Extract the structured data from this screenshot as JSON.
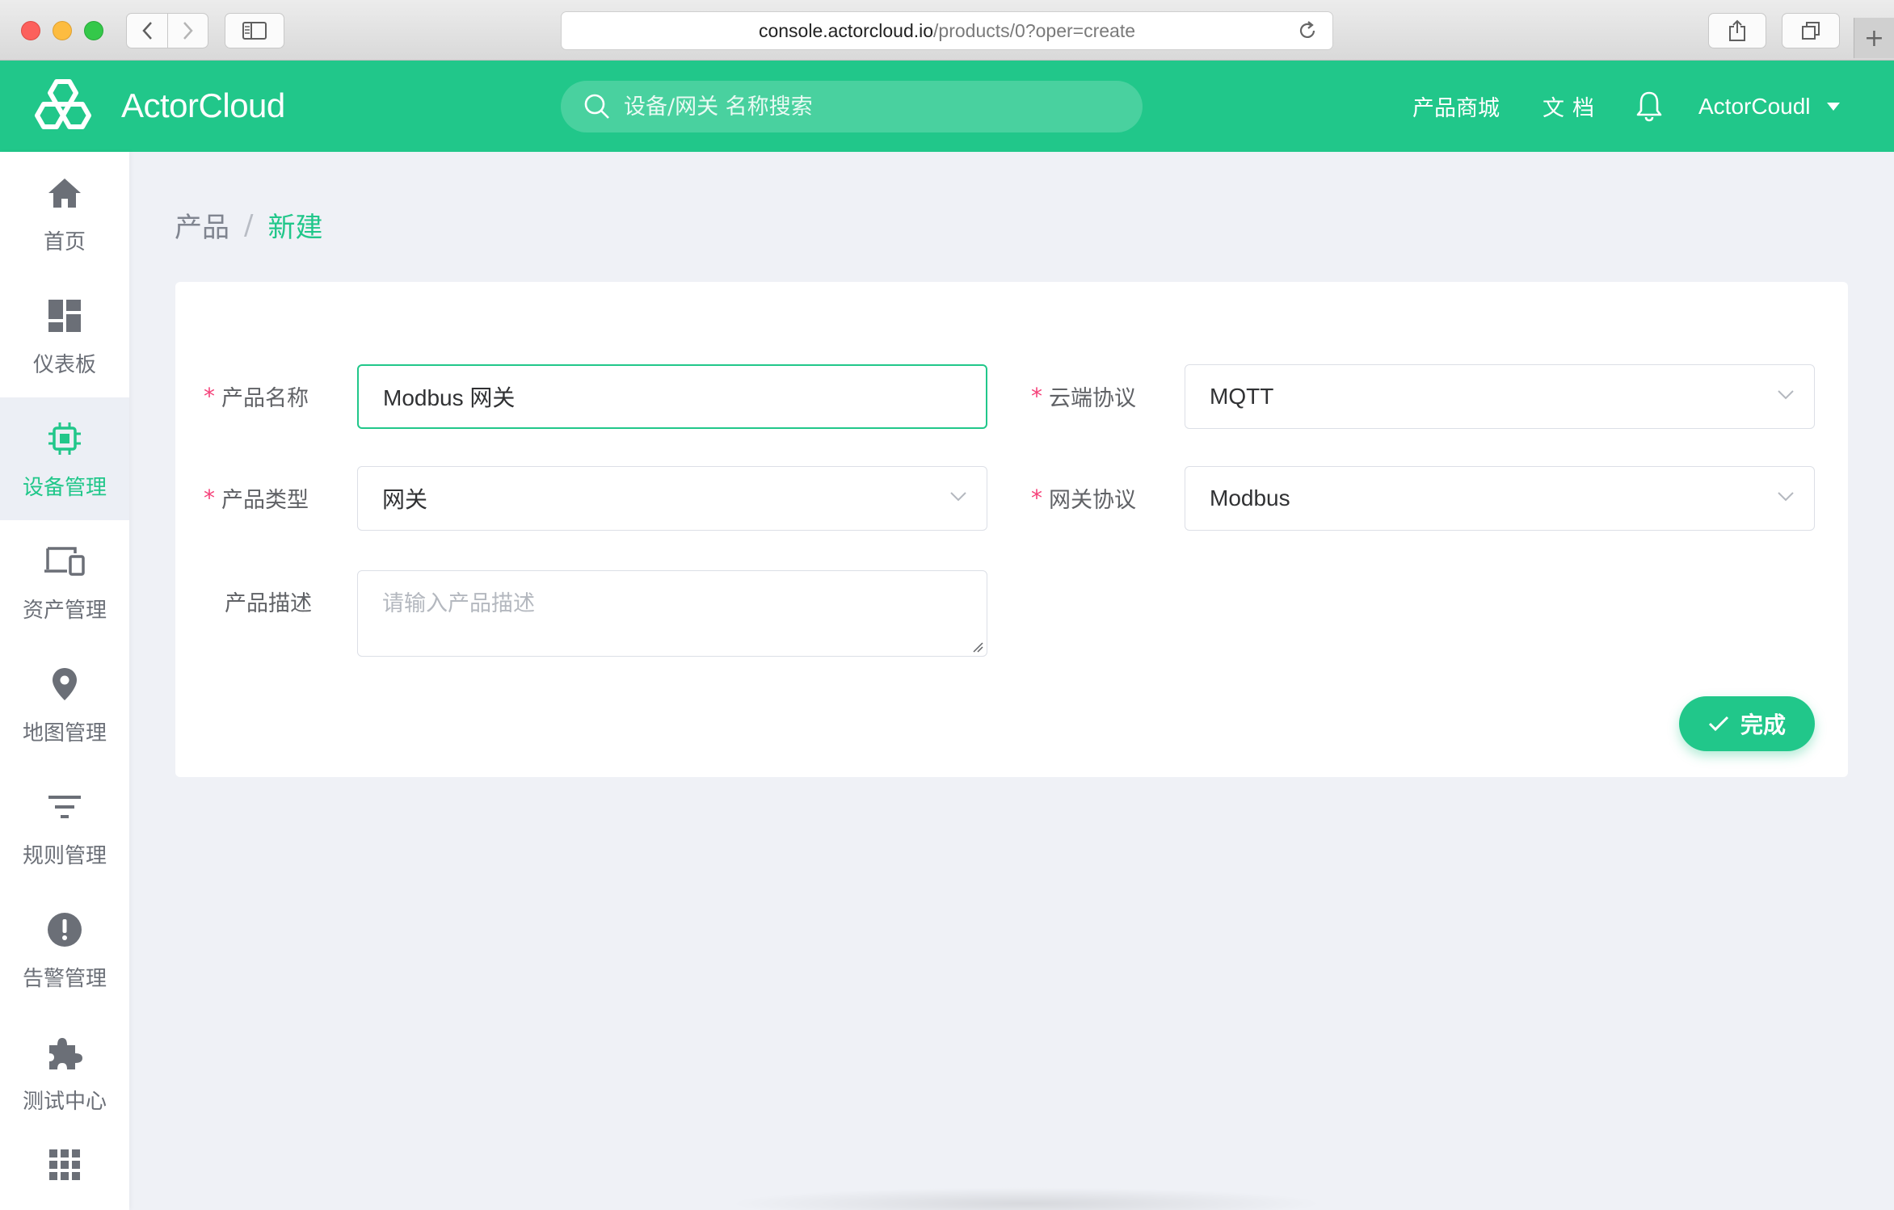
{
  "browser": {
    "url_host": "console.actorcloud.io",
    "url_path": "/products/0?oper=create",
    "icons": [
      "back-icon",
      "forward-icon",
      "sidebar-icon",
      "reload-icon",
      "share-icon",
      "tabs-icon",
      "plus-icon"
    ]
  },
  "header": {
    "brand": "ActorCloud",
    "search_placeholder": "设备/网关 名称搜索",
    "nav_shop": "产品商城",
    "nav_docs": "文档",
    "user_name": "ActorCoudl",
    "accent": "#21c78a"
  },
  "sidebar": {
    "items": [
      {
        "label": "首页",
        "icon": "home-icon"
      },
      {
        "label": "仪表板",
        "icon": "dashboard-icon"
      },
      {
        "label": "设备管理",
        "icon": "chip-icon",
        "active": true
      },
      {
        "label": "资产管理",
        "icon": "devices-icon"
      },
      {
        "label": "地图管理",
        "icon": "map-pin-icon"
      },
      {
        "label": "规则管理",
        "icon": "filter-icon"
      },
      {
        "label": "告警管理",
        "icon": "alert-icon"
      },
      {
        "label": "测试中心",
        "icon": "puzzle-icon"
      }
    ],
    "more_icon": "grid-icon"
  },
  "breadcrumb": {
    "parent": "产品",
    "separator": "/",
    "current": "新建"
  },
  "form": {
    "product_name_label": "产品名称",
    "product_name_value": "Modbus 网关",
    "cloud_protocol_label": "云端协议",
    "cloud_protocol_value": "MQTT",
    "product_type_label": "产品类型",
    "product_type_value": "网关",
    "gateway_protocol_label": "网关协议",
    "gateway_protocol_value": "Modbus",
    "description_label": "产品描述",
    "description_placeholder": "请输入产品描述",
    "required_mark": "*",
    "submit_label": "完成"
  }
}
